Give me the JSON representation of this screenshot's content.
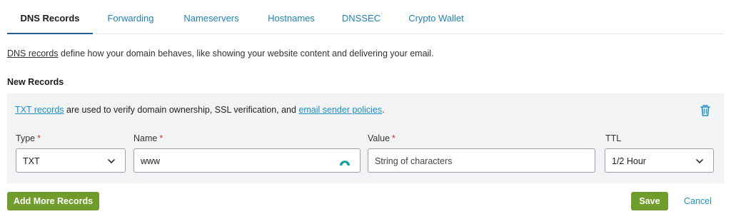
{
  "tabs": [
    {
      "label": "DNS Records",
      "active": true
    },
    {
      "label": "Forwarding",
      "active": false
    },
    {
      "label": "Nameservers",
      "active": false
    },
    {
      "label": "Hostnames",
      "active": false
    },
    {
      "label": "DNSSEC",
      "active": false
    },
    {
      "label": "Crypto Wallet",
      "active": false
    }
  ],
  "intro": {
    "link_text": "DNS records",
    "text": " define how your domain behaves, like showing your website content and delivering your email."
  },
  "new_records": {
    "title": "New Records",
    "info": {
      "link1": "TXT records",
      "text1": " are used to verify domain ownership, SSL verification, and ",
      "link2": "email sender policies",
      "text2": "."
    },
    "fields": {
      "type": {
        "label": "Type",
        "required_mark": "*",
        "value": "TXT"
      },
      "name": {
        "label": "Name",
        "required_mark": "*",
        "value": "www"
      },
      "value": {
        "label": "Value",
        "required_mark": "*",
        "placeholder": "String of characters"
      },
      "ttl": {
        "label": "TTL",
        "value": "1/2 Hour"
      }
    }
  },
  "actions": {
    "add_more": "Add More Records",
    "save": "Save",
    "cancel": "Cancel"
  },
  "colors": {
    "accent_green": "#6f9c2b",
    "link_blue": "#1f8fc8",
    "required_red": "#c0392b",
    "panel_bg": "#f2f3f4"
  },
  "icons": {
    "delete": "trash-icon",
    "dropdown": "chevron-down-icon",
    "name_field_addon": "password-manager-icon"
  }
}
